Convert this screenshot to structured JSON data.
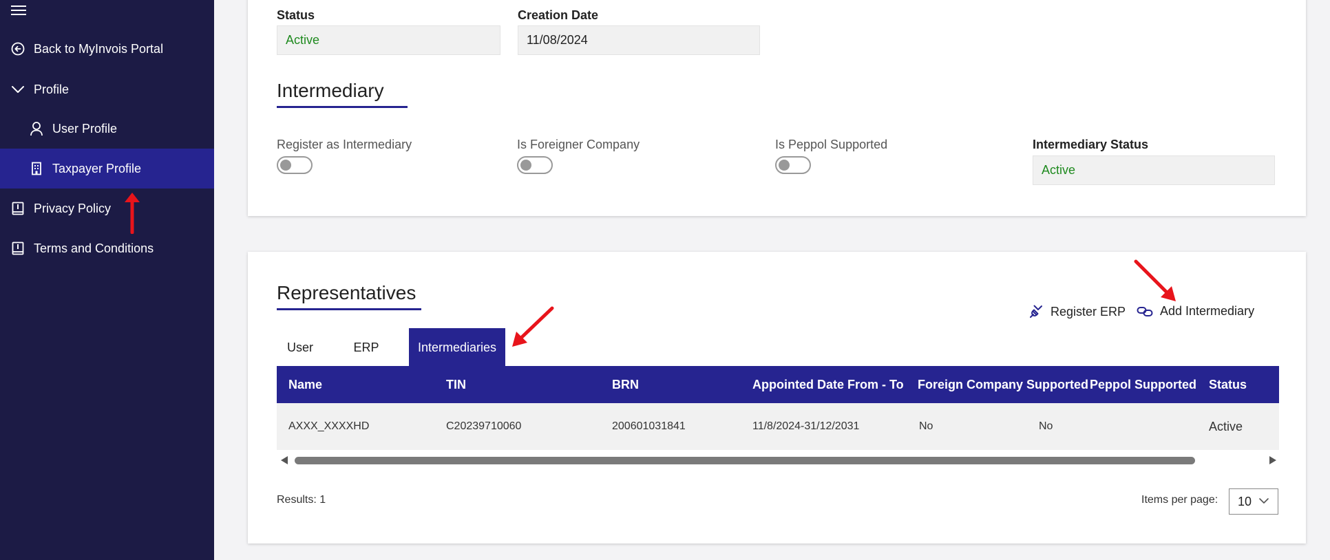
{
  "sidebar": {
    "items": [
      {
        "label": "Back to MyInvois Portal",
        "icon": "arrow-left-circle-icon"
      },
      {
        "label": "Profile",
        "icon": "chevron-down-icon"
      },
      {
        "label": "User Profile",
        "icon": "user-icon"
      },
      {
        "label": "Taxpayer Profile",
        "icon": "building-icon"
      },
      {
        "label": "Privacy Policy",
        "icon": "book-icon"
      },
      {
        "label": "Terms and Conditions",
        "icon": "book-icon"
      }
    ],
    "active_item": "Taxpayer Profile"
  },
  "profile": {
    "status_label": "Status",
    "status_value": "Active",
    "creation_date_label": "Creation Date",
    "creation_date_value": "11/08/2024"
  },
  "intermediary": {
    "title": "Intermediary",
    "register_label": "Register as Intermediary",
    "foreigner_label": "Is Foreigner Company",
    "peppol_label": "Is Peppol Supported",
    "status_label": "Intermediary Status",
    "status_value": "Active"
  },
  "representatives": {
    "title": "Representatives",
    "actions": {
      "register_erp": "Register ERP",
      "add_intermediary": "Add Intermediary"
    },
    "tabs": [
      "User",
      "ERP",
      "Intermediaries"
    ],
    "active_tab": "Intermediaries",
    "columns": [
      "Name",
      "TIN",
      "BRN",
      "Appointed Date From - To",
      "Foreign Company Supported",
      "Peppol Supported",
      "Status"
    ],
    "rows": [
      [
        "AXXX_XXXXHD",
        "C20239710060",
        "200601031841",
        "11/8/2024-31/12/2031",
        "No",
        "No",
        "Active"
      ]
    ],
    "results": "Results: 1",
    "items_per_page_label": "Items per page:",
    "items_per_page_value": "10"
  },
  "colors": {
    "sidebar": "#1c1b45",
    "accent": "#262490",
    "status_green": "#1f8a1f",
    "annotation_red": "#e8141b"
  }
}
